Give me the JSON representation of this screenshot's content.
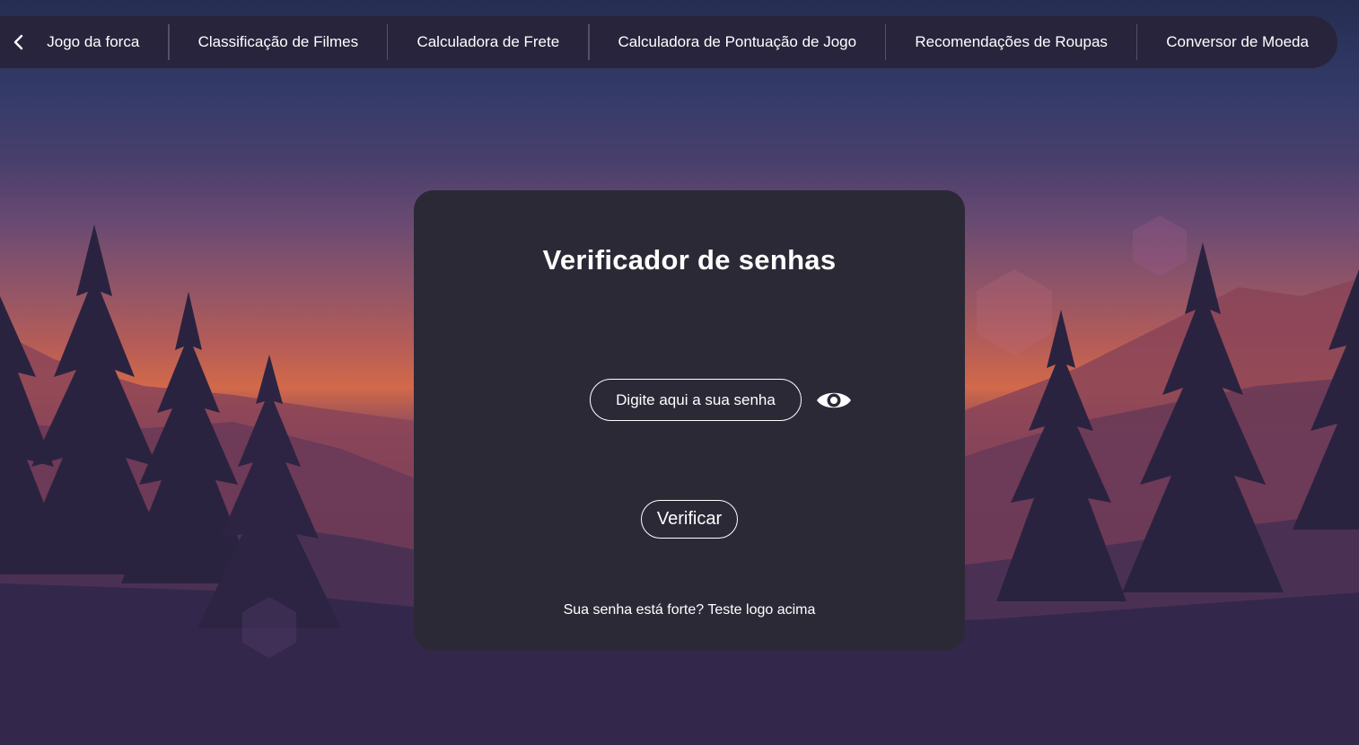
{
  "nav": {
    "back_icon": "chevron-left-icon",
    "items": [
      {
        "label": "Jogo da forca"
      },
      {
        "label": "Classificação de Filmes"
      },
      {
        "label": "Calculadora de Frete"
      },
      {
        "label": "Calculadora de Pontuação de Jogo"
      },
      {
        "label": "Recomendações de Roupas"
      },
      {
        "label": "Conversor de Moeda"
      }
    ]
  },
  "card": {
    "title": "Verificador de senhas",
    "password_placeholder": "Digite aqui a sua senha",
    "password_value": "",
    "toggle_icon": "eye-icon",
    "verify_label": "Verificar",
    "hint": "Sua senha está forte? Teste logo acima"
  },
  "colors": {
    "card_bg": "#2c2937",
    "nav_bg": "#282238",
    "text": "#ffffff",
    "sky_top": "#262d52",
    "sunset": "#d2694a",
    "tree": "#2a2340"
  }
}
